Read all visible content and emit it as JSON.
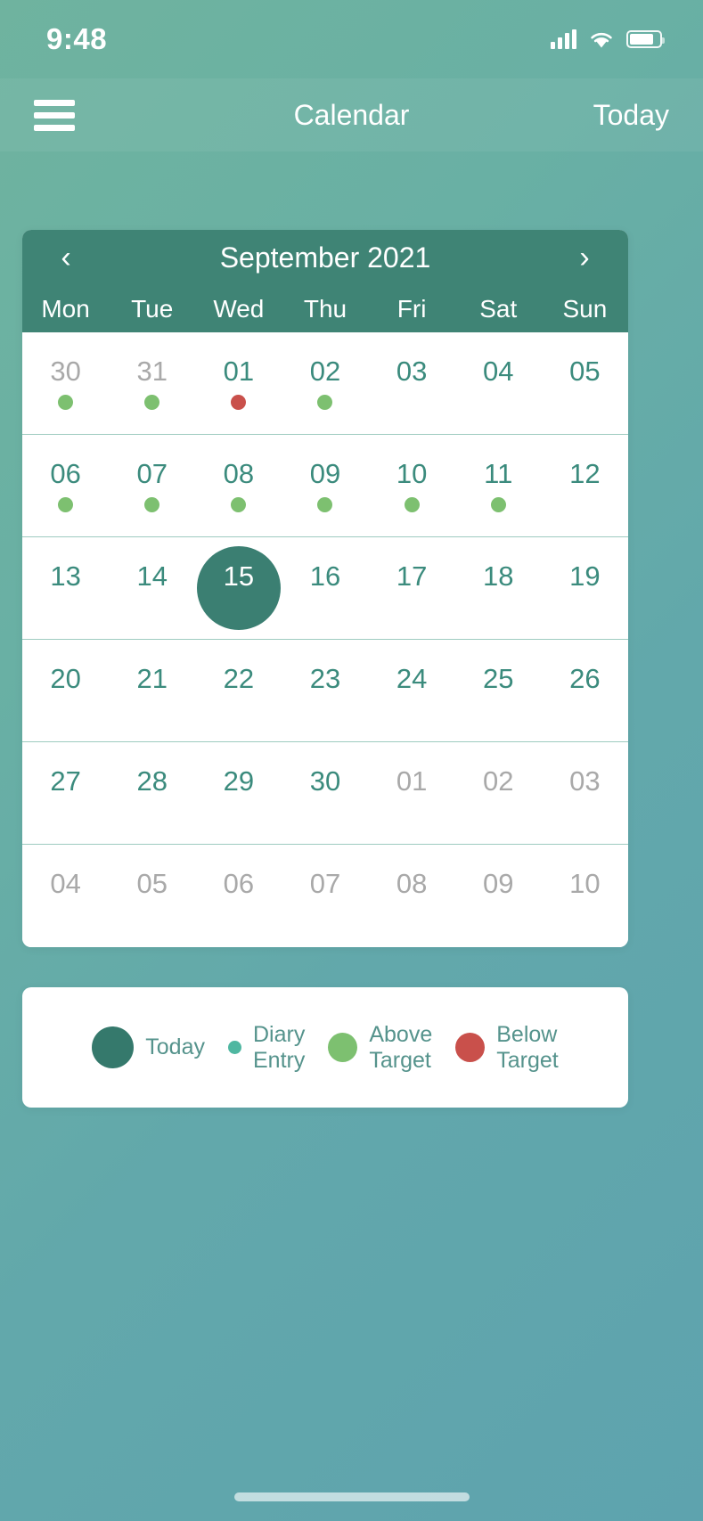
{
  "status_bar": {
    "time": "9:48",
    "cellular_icon": "signal-bars-icon",
    "wifi_icon": "wifi-icon",
    "battery_icon": "battery-icon"
  },
  "nav_bar": {
    "menu_icon": "hamburger-menu-icon",
    "title": "Calendar",
    "today_label": "Today"
  },
  "calendar": {
    "prev_label": "‹",
    "next_label": "›",
    "month_label": "September 2021",
    "weekdays": [
      "Mon",
      "Tue",
      "Wed",
      "Thu",
      "Fri",
      "Sat",
      "Sun"
    ],
    "weeks": [
      [
        {
          "num": "30",
          "out": true,
          "dot": "above",
          "today": false
        },
        {
          "num": "31",
          "out": true,
          "dot": "above",
          "today": false
        },
        {
          "num": "01",
          "out": false,
          "dot": "below",
          "today": false
        },
        {
          "num": "02",
          "out": false,
          "dot": "above",
          "today": false
        },
        {
          "num": "03",
          "out": false,
          "dot": "none",
          "today": false
        },
        {
          "num": "04",
          "out": false,
          "dot": "none",
          "today": false
        },
        {
          "num": "05",
          "out": false,
          "dot": "none",
          "today": false
        }
      ],
      [
        {
          "num": "06",
          "out": false,
          "dot": "above",
          "today": false
        },
        {
          "num": "07",
          "out": false,
          "dot": "above",
          "today": false
        },
        {
          "num": "08",
          "out": false,
          "dot": "above",
          "today": false
        },
        {
          "num": "09",
          "out": false,
          "dot": "above",
          "today": false
        },
        {
          "num": "10",
          "out": false,
          "dot": "above",
          "today": false
        },
        {
          "num": "11",
          "out": false,
          "dot": "above",
          "today": false
        },
        {
          "num": "12",
          "out": false,
          "dot": "none",
          "today": false
        }
      ],
      [
        {
          "num": "13",
          "out": false,
          "dot": "none",
          "today": false
        },
        {
          "num": "14",
          "out": false,
          "dot": "none",
          "today": false
        },
        {
          "num": "15",
          "out": false,
          "dot": "none",
          "today": true
        },
        {
          "num": "16",
          "out": false,
          "dot": "none",
          "today": false
        },
        {
          "num": "17",
          "out": false,
          "dot": "none",
          "today": false
        },
        {
          "num": "18",
          "out": false,
          "dot": "none",
          "today": false
        },
        {
          "num": "19",
          "out": false,
          "dot": "none",
          "today": false
        }
      ],
      [
        {
          "num": "20",
          "out": false,
          "dot": "none",
          "today": false
        },
        {
          "num": "21",
          "out": false,
          "dot": "none",
          "today": false
        },
        {
          "num": "22",
          "out": false,
          "dot": "none",
          "today": false
        },
        {
          "num": "23",
          "out": false,
          "dot": "none",
          "today": false
        },
        {
          "num": "24",
          "out": false,
          "dot": "none",
          "today": false
        },
        {
          "num": "25",
          "out": false,
          "dot": "none",
          "today": false
        },
        {
          "num": "26",
          "out": false,
          "dot": "none",
          "today": false
        }
      ],
      [
        {
          "num": "27",
          "out": false,
          "dot": "none",
          "today": false
        },
        {
          "num": "28",
          "out": false,
          "dot": "none",
          "today": false
        },
        {
          "num": "29",
          "out": false,
          "dot": "none",
          "today": false
        },
        {
          "num": "30",
          "out": false,
          "dot": "none",
          "today": false
        },
        {
          "num": "01",
          "out": true,
          "dot": "none",
          "today": false
        },
        {
          "num": "02",
          "out": true,
          "dot": "none",
          "today": false
        },
        {
          "num": "03",
          "out": true,
          "dot": "none",
          "today": false
        }
      ],
      [
        {
          "num": "04",
          "out": true,
          "dot": "none",
          "today": false
        },
        {
          "num": "05",
          "out": true,
          "dot": "none",
          "today": false
        },
        {
          "num": "06",
          "out": true,
          "dot": "none",
          "today": false
        },
        {
          "num": "07",
          "out": true,
          "dot": "none",
          "today": false
        },
        {
          "num": "08",
          "out": true,
          "dot": "none",
          "today": false
        },
        {
          "num": "09",
          "out": true,
          "dot": "none",
          "today": false
        },
        {
          "num": "10",
          "out": true,
          "dot": "none",
          "today": false
        }
      ]
    ]
  },
  "legend": [
    {
      "key": "today",
      "label": "Today"
    },
    {
      "key": "diary",
      "label": "Diary\nEntry"
    },
    {
      "key": "above",
      "label": "Above\nTarget"
    },
    {
      "key": "below",
      "label": "Below\nTarget"
    }
  ],
  "colors": {
    "header_teal": "#3f8475",
    "today_circle": "#3b7f72",
    "above_target": "#7dc070",
    "below_target": "#c9504b",
    "diary_entry": "#4fb7a1",
    "day_text": "#3b8b7d",
    "out_day_text": "#a9a9a9",
    "background_start": "#6fb39f",
    "background_end": "#5ea3ae"
  },
  "home_indicator": "home-indicator-bar"
}
